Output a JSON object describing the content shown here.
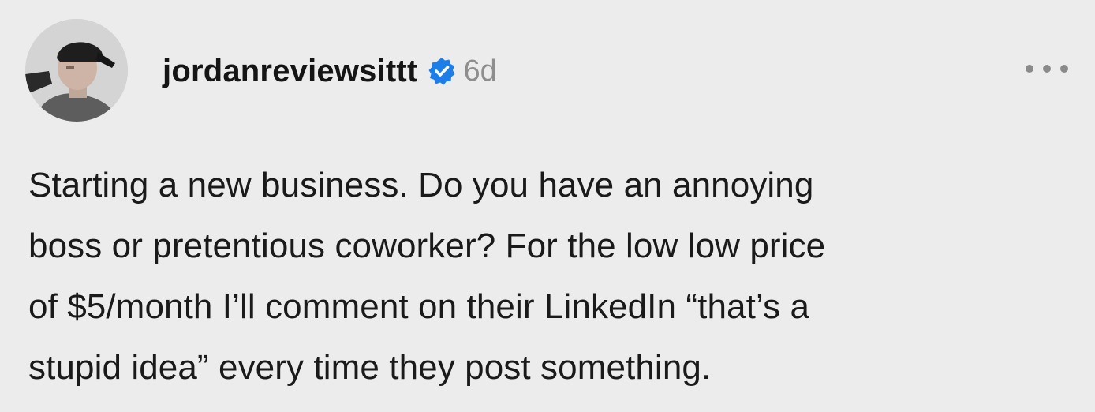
{
  "post": {
    "username": "jordanreviewsittt",
    "timestamp": "6d",
    "verified": true,
    "text_lines": [
      "Starting a new business. Do you have an annoying",
      "boss or pretentious coworker? For the low low price",
      "of $5/month I’ll comment on their LinkedIn “that’s a",
      "stupid idea” every time they post something."
    ]
  },
  "icons": {
    "verified": "verified-badge-icon",
    "more": "more-options-icon"
  },
  "colors": {
    "background": "#ececec",
    "verified_badge": "#1d7ee8",
    "timestamp": "#8e8e8e"
  }
}
